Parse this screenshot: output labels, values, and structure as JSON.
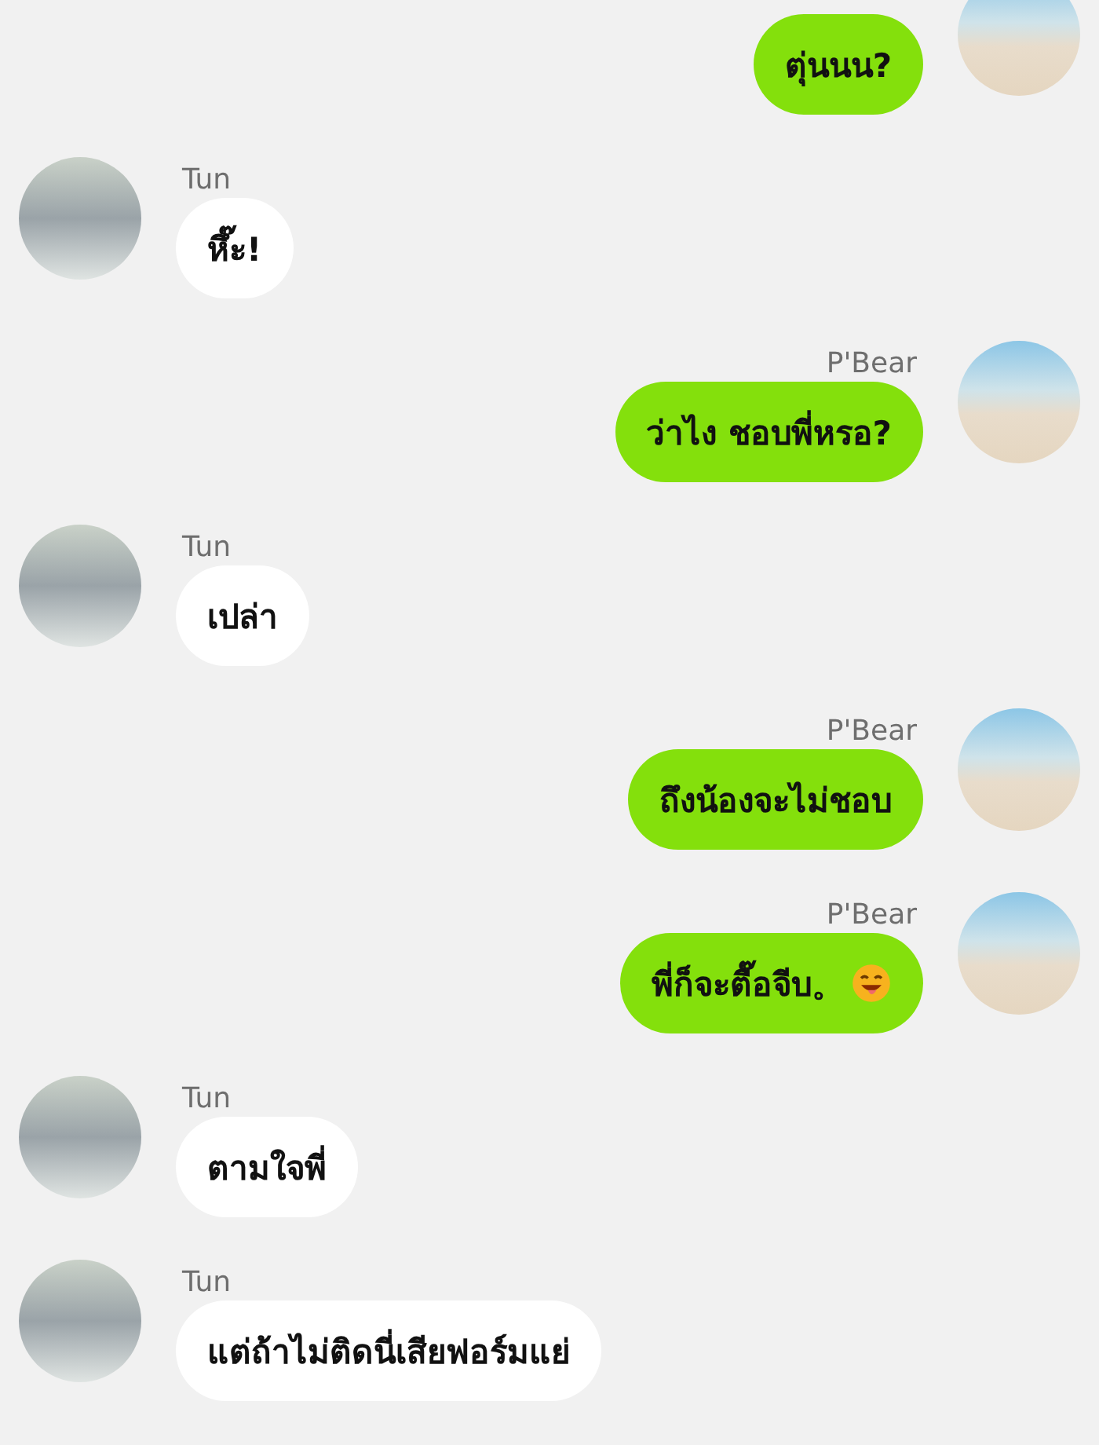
{
  "messages": [
    {
      "kind": "outgoing",
      "text": "ตุ่นนน?"
    },
    {
      "kind": "incoming",
      "name": "Tun",
      "text": "หึ๊ะ!"
    },
    {
      "kind": "outgoing",
      "name": "P'Bear",
      "text": "ว่าไง ชอบพี่หรอ?"
    },
    {
      "kind": "incoming",
      "name": "Tun",
      "text": "เปล่า"
    },
    {
      "kind": "outgoing",
      "name": "P'Bear",
      "text": "ถึงน้องจะไม่ชอบ"
    },
    {
      "kind": "outgoing",
      "name": "P'Bear",
      "text": "พี่ก็จะตื๊อจีบ。",
      "emoji_icon": true
    },
    {
      "kind": "incoming",
      "name": "Tun",
      "text": "ตามใจพี่"
    },
    {
      "kind": "incoming",
      "name": "Tun",
      "text": "แต่ถ้าไม่ติดนี่เสียฟอร์มแย่"
    }
  ]
}
